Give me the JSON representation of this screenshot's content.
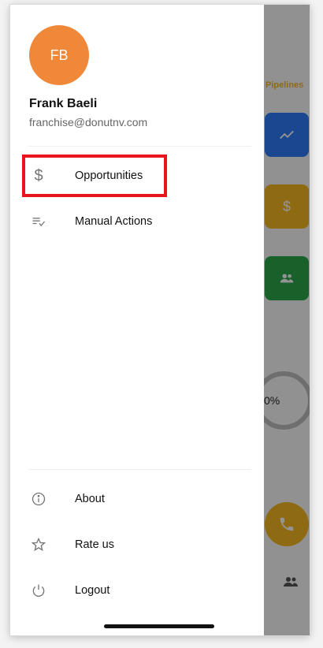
{
  "colors": {
    "avatar": "#F0883A",
    "accent_yellow": "#F4B71F",
    "card_blue": "#2E7BF6",
    "card_yellow": "#F4B71F",
    "card_green": "#2AA84A",
    "ring_gray": "#BDBDBD",
    "highlight_red": "#E8141B"
  },
  "user": {
    "initials": "FB",
    "name": "Frank Baeli",
    "email": "franchise@donutnv.com"
  },
  "menu": {
    "primary": [
      {
        "label": "Opportunities",
        "icon": "dollar-icon"
      },
      {
        "label": "Manual Actions",
        "icon": "checklist-icon"
      }
    ],
    "secondary": [
      {
        "label": "About",
        "icon": "info-icon"
      },
      {
        "label": "Rate us",
        "icon": "star-outline-icon"
      },
      {
        "label": "Logout",
        "icon": "power-icon"
      }
    ]
  },
  "background": {
    "pipelines_label": "Pipelines",
    "progress_text": "0%"
  }
}
